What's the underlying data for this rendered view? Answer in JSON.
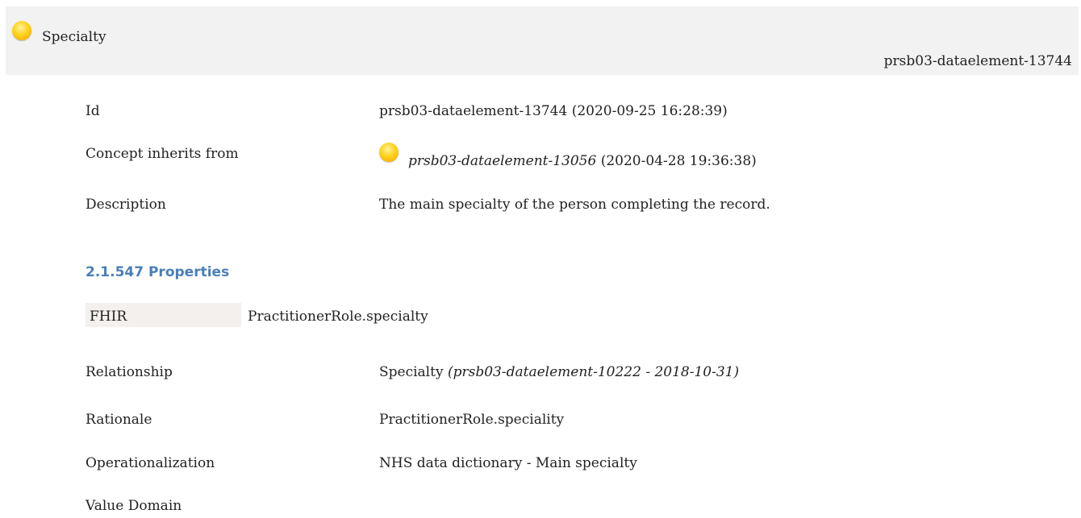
{
  "header": {
    "title": "Specialty",
    "id": "prsb03-dataelement-13744"
  },
  "concept": {
    "id_label": "Id",
    "id_value": "prsb03-dataelement-13744 (2020-09-25 16:28:39)",
    "inherits_label": "Concept inherits from",
    "inherits_ref": "prsb03-dataelement-13056",
    "inherits_date": " (2020-04-28 19:36:38)",
    "description_label": "Description",
    "description_value": "The main specialty of the person completing the record."
  },
  "properties": {
    "heading": "2.1.547 Properties",
    "fhir_label": "FHIR",
    "fhir_value": "PractitionerRole.specialty",
    "relationship_label": "Relationship",
    "relationship_name": "Specialty",
    "relationship_ref": " (prsb03-dataelement-10222 - 2018-10-31)",
    "rationale_label": "Rationale",
    "rationale_value": "PractitionerRole.speciality",
    "operationalization_label": "Operationalization",
    "operationalization_value": "NHS data dictionary - Main specialty",
    "value_domain_label": "Value Domain"
  },
  "icons": {
    "status": "status-orb-icon"
  },
  "colors": {
    "header_bg": "#f2f2f2",
    "section_heading": "#4a7fb8",
    "status_orb": "#ffd21c",
    "fhir_box_bg": "#f3f0ee"
  }
}
